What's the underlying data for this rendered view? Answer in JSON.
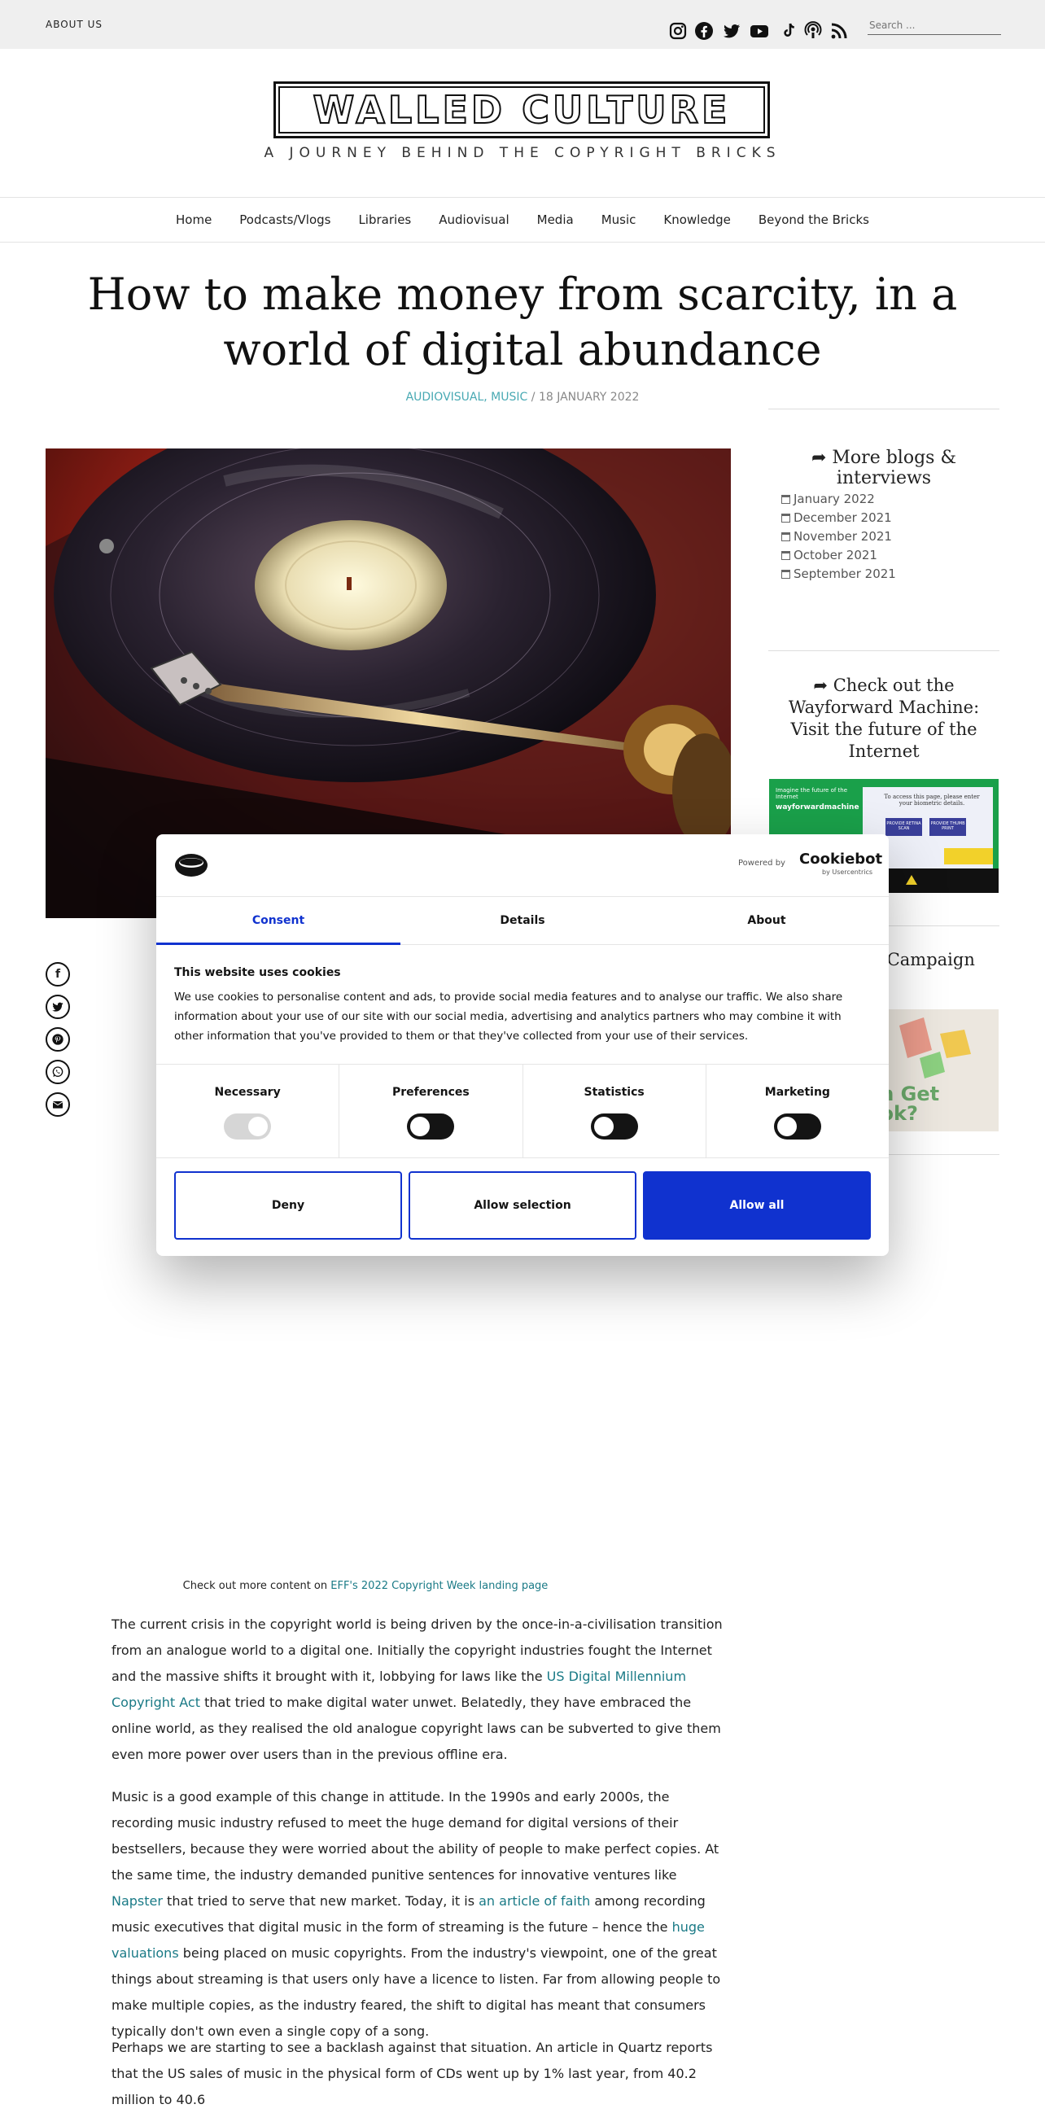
{
  "topbar": {
    "about_label": "ABOUT US",
    "social_icons": [
      "instagram-icon",
      "facebook-icon",
      "twitter-icon",
      "youtube-icon",
      "tiktok-icon",
      "podcast-icon",
      "rss-icon"
    ],
    "search_placeholder": "Search ..."
  },
  "site": {
    "logo_text": "WALLED CULTURE",
    "tagline": "A JOURNEY BEHIND THE COPYRIGHT BRICKS"
  },
  "nav": {
    "items": [
      "Home",
      "Podcasts/Vlogs",
      "Libraries",
      "Audiovisual",
      "Media",
      "Music",
      "Knowledge",
      "Beyond the Bricks"
    ]
  },
  "post": {
    "title": "How to make money from scarcity, in a world of digital abundance",
    "categories": "AUDIOVISUAL, MUSIC",
    "separator": "/",
    "date": "18 JANUARY 2022",
    "share_icons": [
      "facebook-icon",
      "twitter-icon",
      "pinterest-icon",
      "whatsapp-icon",
      "email-icon"
    ]
  },
  "sidebar": {
    "more_title": "More blogs & interviews",
    "archive": [
      "January 2022",
      "December 2021",
      "November 2021",
      "October 2021",
      "September 2021"
    ],
    "wayforward_title": "Check out the Wayforward Machine: Visit the future of the Internet",
    "fight_title": "t Fight for Campaign",
    "fight_img_text": "an Get ook?"
  },
  "wayforward_img": {
    "left_text": "Imagine the future of the Internet",
    "brand": "wayforwardmachine",
    "prompt": "To access this page, please enter your biometric details.",
    "btn1": "PROVIDE RETINA SCAN",
    "btn2": "PROVIDE THUMB PRINT"
  },
  "cookie": {
    "powered_by": "Powered by",
    "brand": "Cookiebot",
    "brand_sub": "by Usercentrics",
    "tabs": [
      "Consent",
      "Details",
      "About"
    ],
    "heading": "This website uses cookies",
    "body": "We use cookies to personalise content and ads, to provide social media features and to analyse our traffic. We also share information about your use of our site with our social media, advertising and analytics partners who may combine it with other information that you've provided to them or that they've collected from your use of their services.",
    "toggles": [
      {
        "label": "Necessary",
        "on": true,
        "disabled": true
      },
      {
        "label": "Preferences",
        "on": false
      },
      {
        "label": "Statistics",
        "on": false
      },
      {
        "label": "Marketing",
        "on": false
      }
    ],
    "deny": "Deny",
    "allow_selection": "Allow selection",
    "allow_all": "Allow all"
  },
  "article": {
    "eff_prefix": "Check out more content on ",
    "eff_link": "EFF's 2022 Copyright Week landing page",
    "p1_a": "The current crisis in the copyright world is being driven by the once-in-a-civilisation transition from an analogue world to a digital one. Initially the copyright industries fought the Internet and the massive shifts it brought with it, lobbying for laws like the ",
    "p1_link": "US Digital Millennium Copyright Act",
    "p1_b": " that tried to make digital water unwet. Belatedly, they have embraced the online world, as they realised the old analogue copyright laws can be subverted to give them even more power over users than in the previous offline era.",
    "p2_a": "Music is a good example of this change in attitude. In the 1990s and early 2000s, the recording music industry refused to meet the huge demand for digital versions of their bestsellers, because they were worried about the ability of people to make perfect copies. At the same time, the industry demanded punitive sentences for innovative ventures like ",
    "p2_link1": "Napster",
    "p2_b": " that tried to serve that new market. Today, it is ",
    "p2_link2": "an article of faith",
    "p2_c": " among recording music executives that digital music in the form of streaming is the future – hence the ",
    "p2_link3": "huge valuations",
    "p2_d": " being placed on music copyrights. From the industry's viewpoint, one of the great things about streaming is that users only have a licence to listen. Far from allowing people to make multiple copies, as the industry feared, the shift to digital has meant that consumers typically don't own even a single copy of a song.",
    "p3": "Perhaps we are starting to see a backlash against that situation. An article in Quartz reports that the US sales of music in the physical form of CDs went up by 1% last year, from 40.2 million to 40.6"
  }
}
